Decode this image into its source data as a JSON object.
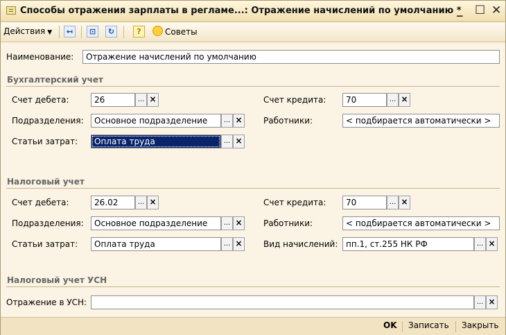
{
  "window": {
    "title": "Способы отражения зарплаты в регламе...: Отражение начислений по умолчанию *",
    "minimize": "_",
    "maximize": "☐",
    "close": "✕"
  },
  "toolbar": {
    "actions_label": "Действия",
    "advice_label": "Советы",
    "icons": [
      "insert-row-icon",
      "report-icon",
      "refresh-icon",
      "help-icon",
      "advice-icon"
    ]
  },
  "form": {
    "name_label": "Наименование:",
    "name_value": "Отражение начислений по умолчанию",
    "accounting": {
      "title": "Бухгалтерский учет",
      "debit_label": "Счет дебета:",
      "debit_value": "26",
      "credit_label": "Счет кредита:",
      "credit_value": "70",
      "dept_label": "Подразделения:",
      "dept_value": "Основное подразделение",
      "employees_label": "Работники:",
      "employees_value": "< подбирается автоматически >",
      "cost_items_label": "Статьи затрат:",
      "cost_items_value": "Оплата труда"
    },
    "tax": {
      "title": "Налоговый учет",
      "debit_label": "Счет дебета:",
      "debit_value": "26.02",
      "credit_label": "Счет кредита:",
      "credit_value": "70",
      "dept_label": "Подразделения:",
      "dept_value": "Основное подразделение",
      "employees_label": "Работники:",
      "employees_value": "< подбирается автоматически >",
      "cost_items_label": "Статьи затрат:",
      "cost_items_value": "Оплата труда",
      "accrual_type_label": "Вид начислений:",
      "accrual_type_value": "пп.1, ст.255 НК РФ"
    },
    "usn": {
      "title": "Налоговый учет УСН",
      "reflection_label": "Отражение в УСН:",
      "reflection_value": ""
    },
    "buttons": {
      "choose": "...",
      "clear": "×"
    }
  },
  "footer": {
    "ok": "OK",
    "save": "Записать",
    "close": "Закрыть"
  }
}
